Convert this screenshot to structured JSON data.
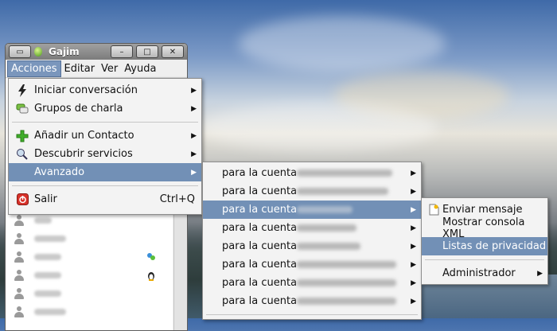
{
  "window": {
    "title": "Gajim",
    "menubar": [
      "Acciones",
      "Editar",
      "Ver",
      "Ayuda"
    ]
  },
  "acciones_menu": {
    "items": [
      {
        "label": "Iniciar conversación",
        "icon": "lightning-icon",
        "submenu": true
      },
      {
        "label": "Grupos de charla",
        "icon": "chat-bubbles-icon",
        "submenu": true
      },
      {
        "label": "Añadir un Contacto",
        "icon": "add-plus-icon",
        "submenu": true
      },
      {
        "label": "Descubrir servicios",
        "icon": "discover-search-icon",
        "submenu": true
      },
      {
        "label": "Avanzado",
        "icon": "",
        "submenu": true,
        "selected": true
      },
      {
        "label": "Salir",
        "icon": "quit-power-icon",
        "shortcut": "Ctrl+Q"
      }
    ]
  },
  "accounts_menu": {
    "items": [
      {
        "label": "para la cuenta"
      },
      {
        "label": "para la cuenta"
      },
      {
        "label": "para la cuenta",
        "selected": true
      },
      {
        "label": "para la cuenta"
      },
      {
        "label": "para la cuenta"
      },
      {
        "label": "para la cuenta"
      },
      {
        "label": "para la cuenta"
      },
      {
        "label": "para la cuenta"
      }
    ]
  },
  "account_submenu": {
    "items": [
      {
        "label": "Enviar mensaje",
        "icon": "send-message-icon"
      },
      {
        "label": "Mostrar consola XML"
      },
      {
        "label": "Listas de privacidad",
        "selected": true
      },
      {
        "label": "Administrador",
        "submenu": true
      }
    ]
  },
  "colors": {
    "selection": "#7290b6",
    "menu_bg": "#f3f3f3"
  }
}
